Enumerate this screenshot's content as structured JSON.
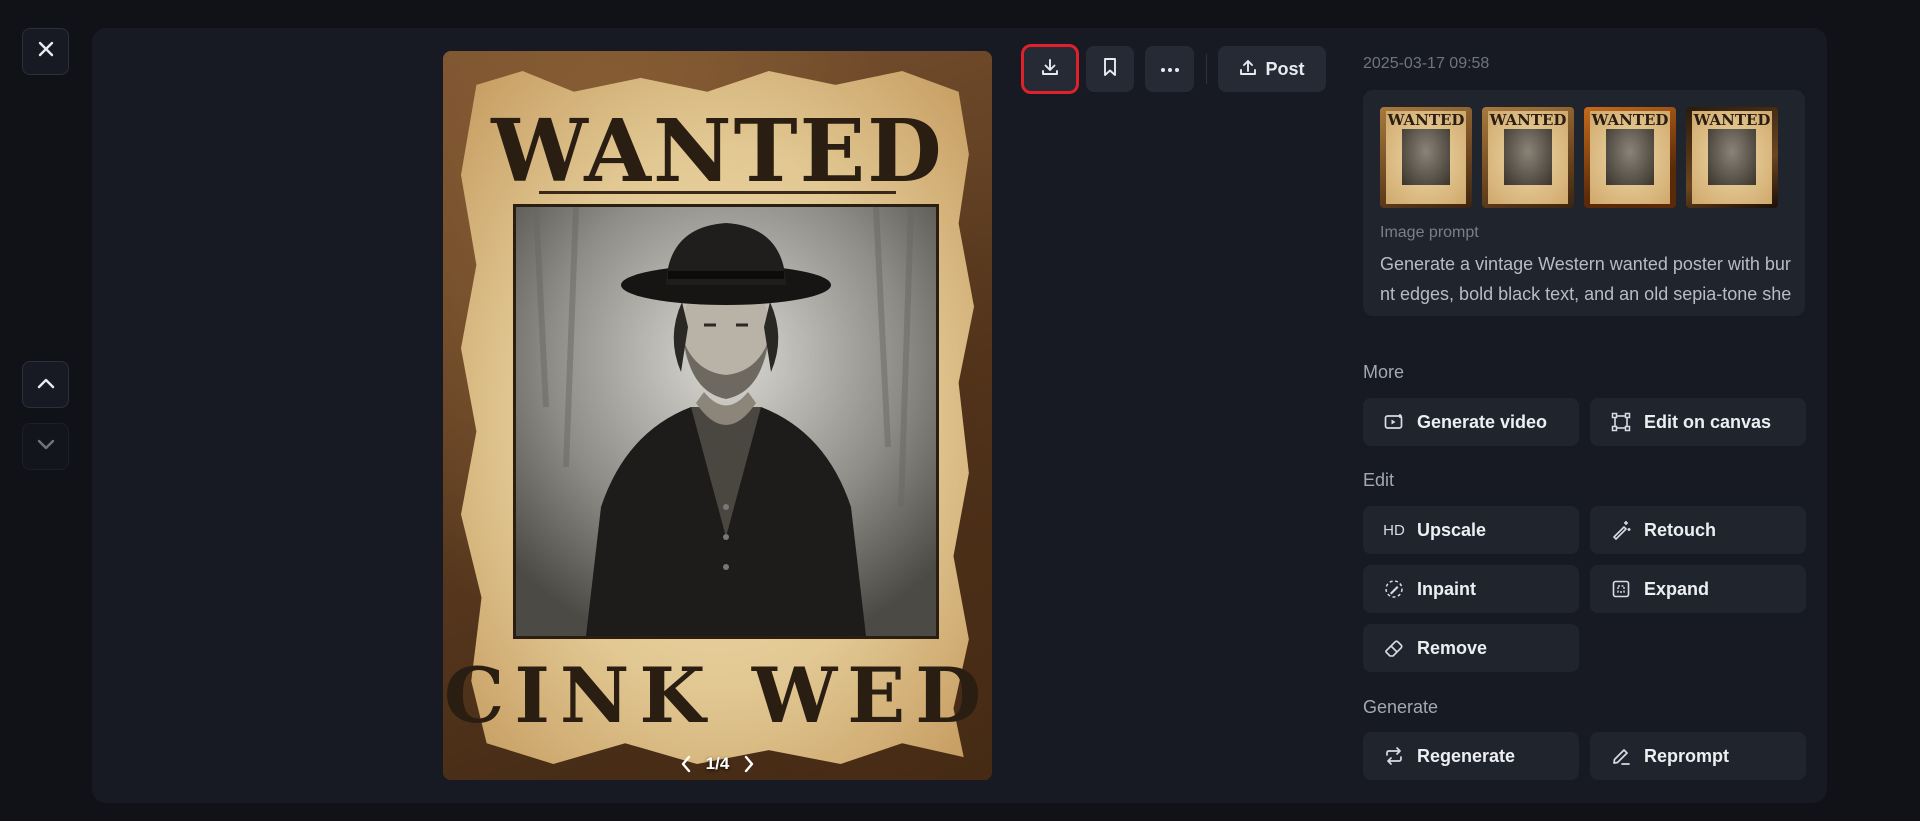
{
  "navigation": {
    "close_icon": "close-icon",
    "up_icon": "chevron-up-icon",
    "down_icon": "chevron-down-icon"
  },
  "toolbar": {
    "download_icon": "download-icon",
    "bookmark_icon": "bookmark-icon",
    "more_icon": "more-horizontal-icon",
    "post_label": "Post",
    "highlight_color": "#e0202a"
  },
  "image": {
    "poster_title": "WANTED",
    "poster_bottom_text": "CINK WED",
    "pager": "1/4"
  },
  "details": {
    "timestamp": "2025-03-17 09:58",
    "thumbnail_titles": [
      "WANTED",
      "WANTED",
      "WANTED",
      "WANTED"
    ],
    "prompt_label": "Image prompt",
    "prompt_text": "Generate a vintage Western wanted poster with burnt edges, bold black text, and an old sepia-tone sheriff portrait."
  },
  "sections": {
    "more": {
      "label": "More",
      "actions": [
        {
          "label": "Generate video",
          "icon": "video-plus-icon"
        },
        {
          "label": "Edit on canvas",
          "icon": "canvas-frame-icon"
        }
      ]
    },
    "edit": {
      "label": "Edit",
      "actions": [
        {
          "label": "Upscale",
          "icon": "hd-icon",
          "icon_text": "HD"
        },
        {
          "label": "Retouch",
          "icon": "magic-wand-icon"
        },
        {
          "label": "Inpaint",
          "icon": "inpaint-brush-icon"
        },
        {
          "label": "Expand",
          "icon": "expand-icon"
        },
        {
          "label": "Remove",
          "icon": "eraser-icon"
        }
      ]
    },
    "generate": {
      "label": "Generate",
      "actions": [
        {
          "label": "Regenerate",
          "icon": "repeat-icon"
        },
        {
          "label": "Reprompt",
          "icon": "pencil-icon"
        }
      ]
    }
  },
  "colors": {
    "background": "#101218",
    "panel": "#171a22",
    "button": "#20242d",
    "muted_text": "#7a7f8b"
  }
}
